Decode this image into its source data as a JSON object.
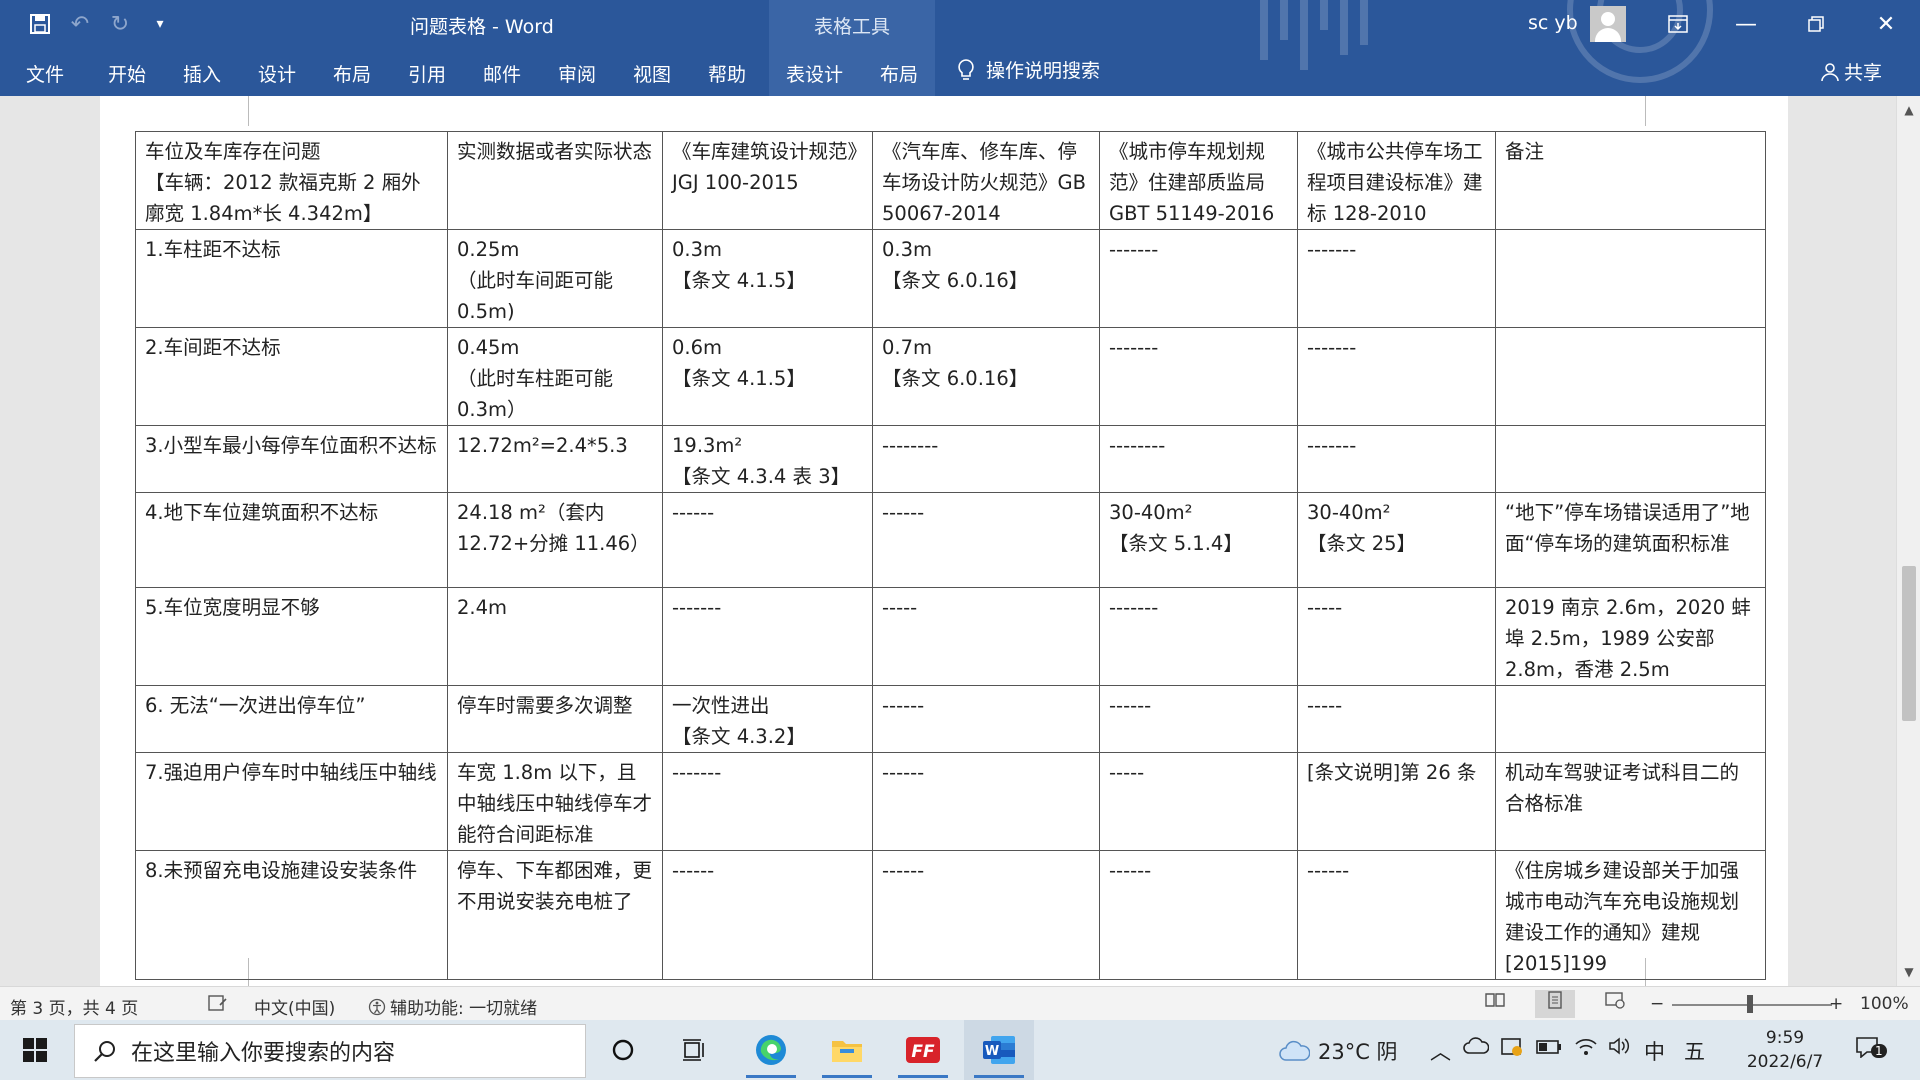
{
  "titlebar": {
    "doc_title": "问题表格 - Word",
    "table_tools": "表格工具",
    "user_name": "sc yb"
  },
  "tabs": [
    "文件",
    "开始",
    "插入",
    "设计",
    "布局",
    "引用",
    "邮件",
    "审阅",
    "视图",
    "帮助",
    "表设计",
    "布局"
  ],
  "tell_me": "操作说明搜索",
  "share": "共享",
  "table": {
    "header": [
      [
        "车位及车库存在问题",
        "【车辆：2012 款福克斯 2 厢外廓宽 1.84m*长 4.342m】"
      ],
      [
        "实测数据或者实际状态"
      ],
      [
        "《车库建筑设计规范》JGJ 100-2015"
      ],
      [
        "《汽车库、修车库、停车场设计防火规范》GB 50067-2014"
      ],
      [
        "《城市停车规划规范》住建部质监局 GBT 51149-2016"
      ],
      [
        "《城市公共停车场工程项目建设标准》建标 128-2010"
      ],
      [
        "备注"
      ]
    ],
    "rows": [
      [
        [
          "1.车柱距不达标"
        ],
        [
          "0.25m",
          "（此时车间距可能 0.5m)"
        ],
        [
          "0.3m",
          "【条文 4.1.5】"
        ],
        [
          "0.3m",
          "【条文 6.0.16】"
        ],
        [
          "-------"
        ],
        [
          "-------"
        ],
        [
          ""
        ]
      ],
      [
        [
          "2.车间距不达标"
        ],
        [
          "0.45m",
          "（此时车柱距可能 0.3m）"
        ],
        [
          "0.6m",
          "【条文 4.1.5】"
        ],
        [
          "0.7m",
          "【条文 6.0.16】"
        ],
        [
          "-------"
        ],
        [
          "-------"
        ],
        [
          ""
        ]
      ],
      [
        [
          "3.小型车最小每停车位面积不达标"
        ],
        [
          "12.72m²=2.4*5.3"
        ],
        [
          "19.3m²",
          "【条文 4.3.4 表 3】"
        ],
        [
          "--------"
        ],
        [
          "--------"
        ],
        [
          "-------"
        ],
        [
          ""
        ]
      ],
      [
        [
          "4.地下车位建筑面积不达标"
        ],
        [
          "24.18 m²（套内 12.72+分摊 11.46）"
        ],
        [
          "------"
        ],
        [
          "------"
        ],
        [
          "30-40m²",
          "【条文 5.1.4】"
        ],
        [
          "30-40m²",
          "【条文 25】"
        ],
        [
          "“地下”停车场错误适用了”地面“停车场的建筑面积标准"
        ]
      ],
      [
        [
          "5.车位宽度明显不够"
        ],
        [
          "2.4m"
        ],
        [
          "-------"
        ],
        [
          "-----"
        ],
        [
          "-------"
        ],
        [
          "-----"
        ],
        [
          "2019 南京 2.6m，2020 蚌埠 2.5m，1989 公安部 2.8m，香港 2.5m"
        ]
      ],
      [
        [
          "6. 无法“一次进出停车位”"
        ],
        [
          "停车时需要多次调整"
        ],
        [
          "一次性进出",
          "【条文 4.3.2】"
        ],
        [
          "------"
        ],
        [
          "------"
        ],
        [
          "-----"
        ],
        [
          ""
        ]
      ],
      [
        [
          "7.强迫用户停车时中轴线压中轴线"
        ],
        [
          "车宽 1.8m 以下，且中轴线压中轴线停车才能符合间距标准"
        ],
        [
          "-------"
        ],
        [
          "------"
        ],
        [
          "-----"
        ],
        [
          "[条文说明]第 26 条"
        ],
        [
          "机动车驾驶证考试科目二的合格标准"
        ]
      ],
      [
        [
          "8.未预留充电设施建设安装条件"
        ],
        [
          "停车、下车都困难，更不用说安装充电桩了"
        ],
        [
          "------"
        ],
        [
          "------"
        ],
        [
          "------"
        ],
        [
          "------"
        ],
        [
          "《住房城乡建设部关于加强城市电动汽车充电设施规划建设工作的通知》建规[2015]199"
        ]
      ]
    ]
  },
  "statusbar": {
    "page": "第 3 页，共 4 页",
    "language": "中文(中国)",
    "accessibility": "辅助功能: 一切就绪",
    "zoom": "100%"
  },
  "taskbar": {
    "search_placeholder": "在这里输入你要搜索的内容",
    "weather": "23°C 阴",
    "ime": "中",
    "ime_mode": "五",
    "time": "9:59",
    "date": "2022/6/7",
    "notif_count": "1"
  },
  "colors": {
    "ribbon": "#2b579a",
    "accent": "#3a78c5"
  }
}
